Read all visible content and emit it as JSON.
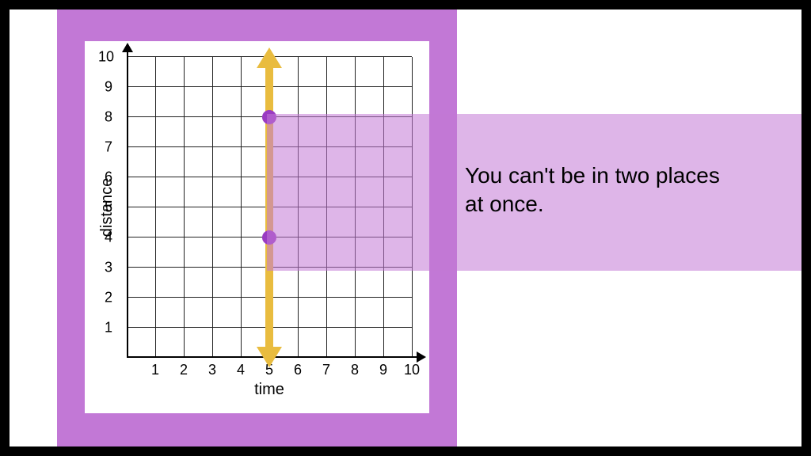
{
  "chart_data": {
    "type": "scatter",
    "xlabel": "time",
    "ylabel": "distance",
    "xlim": [
      0,
      10
    ],
    "ylim": [
      0,
      10
    ],
    "x_ticks": [
      1,
      2,
      3,
      4,
      5,
      6,
      7,
      8,
      9,
      10
    ],
    "y_ticks": [
      1,
      2,
      3,
      4,
      5,
      6,
      7,
      8,
      9,
      10
    ],
    "vertical_line_x": 5,
    "points": [
      {
        "x": 5,
        "y": 8
      },
      {
        "x": 5,
        "y": 4
      }
    ],
    "highlight_band": {
      "y_min": 4,
      "y_max": 8
    }
  },
  "callout": "You can't be in two places at once.",
  "ticks": {
    "x1": "1",
    "x2": "2",
    "x3": "3",
    "x4": "4",
    "x5": "5",
    "x6": "6",
    "x7": "7",
    "x8": "8",
    "x9": "9",
    "x10": "10",
    "y1": "1",
    "y2": "2",
    "y3": "3",
    "y4": "4",
    "y5": "5",
    "y6": "6",
    "y7": "7",
    "y8": "8",
    "y9": "9",
    "y10": "10"
  }
}
